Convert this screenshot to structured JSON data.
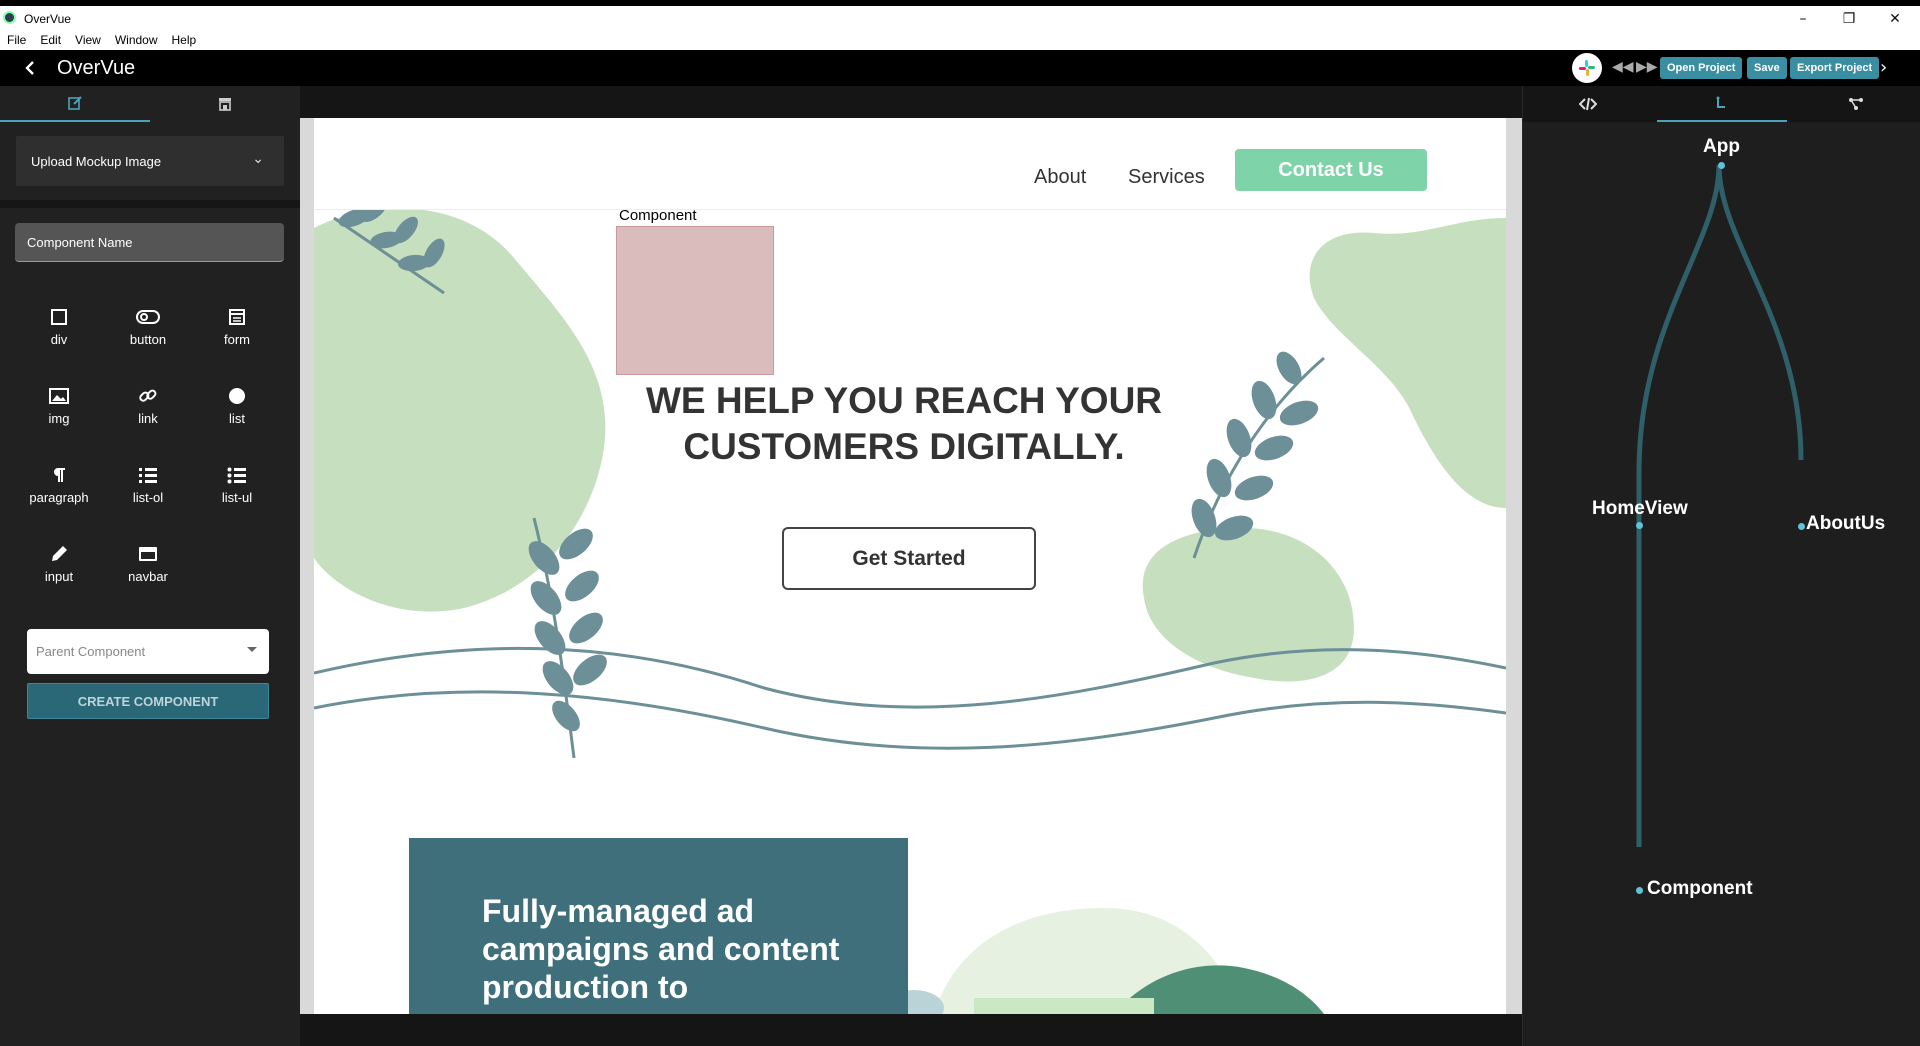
{
  "window": {
    "title": "OverVue",
    "minimize": "–",
    "restore": "❐",
    "close": "✕"
  },
  "menu": [
    "File",
    "Edit",
    "View",
    "Window",
    "Help"
  ],
  "header": {
    "back_icon": "chevron-left-icon",
    "title": "OverVue",
    "buttons": {
      "open": "Open Project",
      "save": "Save",
      "export": "Export Project"
    }
  },
  "sidebar": {
    "tabs": [
      {
        "icon": "edit-icon",
        "active": true
      },
      {
        "icon": "store-icon",
        "active": false
      }
    ],
    "upload_label": "Upload Mockup Image",
    "component_name_placeholder": "Component Name",
    "elements": [
      {
        "label": "div",
        "icon": "square-icon"
      },
      {
        "label": "button",
        "icon": "toggle-icon"
      },
      {
        "label": "form",
        "icon": "calendar-icon"
      },
      {
        "label": "img",
        "icon": "image-icon"
      },
      {
        "label": "link",
        "icon": "link-icon"
      },
      {
        "label": "list",
        "icon": "circle-icon"
      },
      {
        "label": "paragraph",
        "icon": "paragraph-icon"
      },
      {
        "label": "list-ol",
        "icon": "list-ol-icon"
      },
      {
        "label": "list-ul",
        "icon": "list-ul-icon"
      },
      {
        "label": "input",
        "icon": "pencil-icon"
      },
      {
        "label": "navbar",
        "icon": "navbar-icon"
      }
    ],
    "parent_placeholder": "Parent Component",
    "create_label": "CREATE COMPONENT"
  },
  "mockup": {
    "nav_links": [
      "About",
      "Services"
    ],
    "contact_label": "Contact Us",
    "component_label": "Component",
    "headline_line1": "WE HELP YOU REACH YOUR",
    "headline_line2": "CUSTOMERS DIGITALLY.",
    "cta_label": "Get Started",
    "card_text": "Fully-managed ad campaigns and content production to"
  },
  "right_panel": {
    "tabs": [
      {
        "icon": "code-icon",
        "active": false
      },
      {
        "icon": "tree-icon",
        "active": true
      },
      {
        "icon": "graph-icon",
        "active": false
      }
    ],
    "tree": {
      "root": "App",
      "children": [
        "HomeView",
        "AboutUs"
      ],
      "grandchild": "Component"
    }
  },
  "colors": {
    "accent": "#4aa3b8",
    "button_blue": "#3a8ea2",
    "create_button": "#2a6877",
    "tree_line": "#2f5f68",
    "leaf_green": "#c6dfbf",
    "leaf_blue": "#6d8f98",
    "contact_green": "#7fd3a9",
    "teal_card": "#3f6f7a",
    "component_box": "#dbbcbc"
  }
}
